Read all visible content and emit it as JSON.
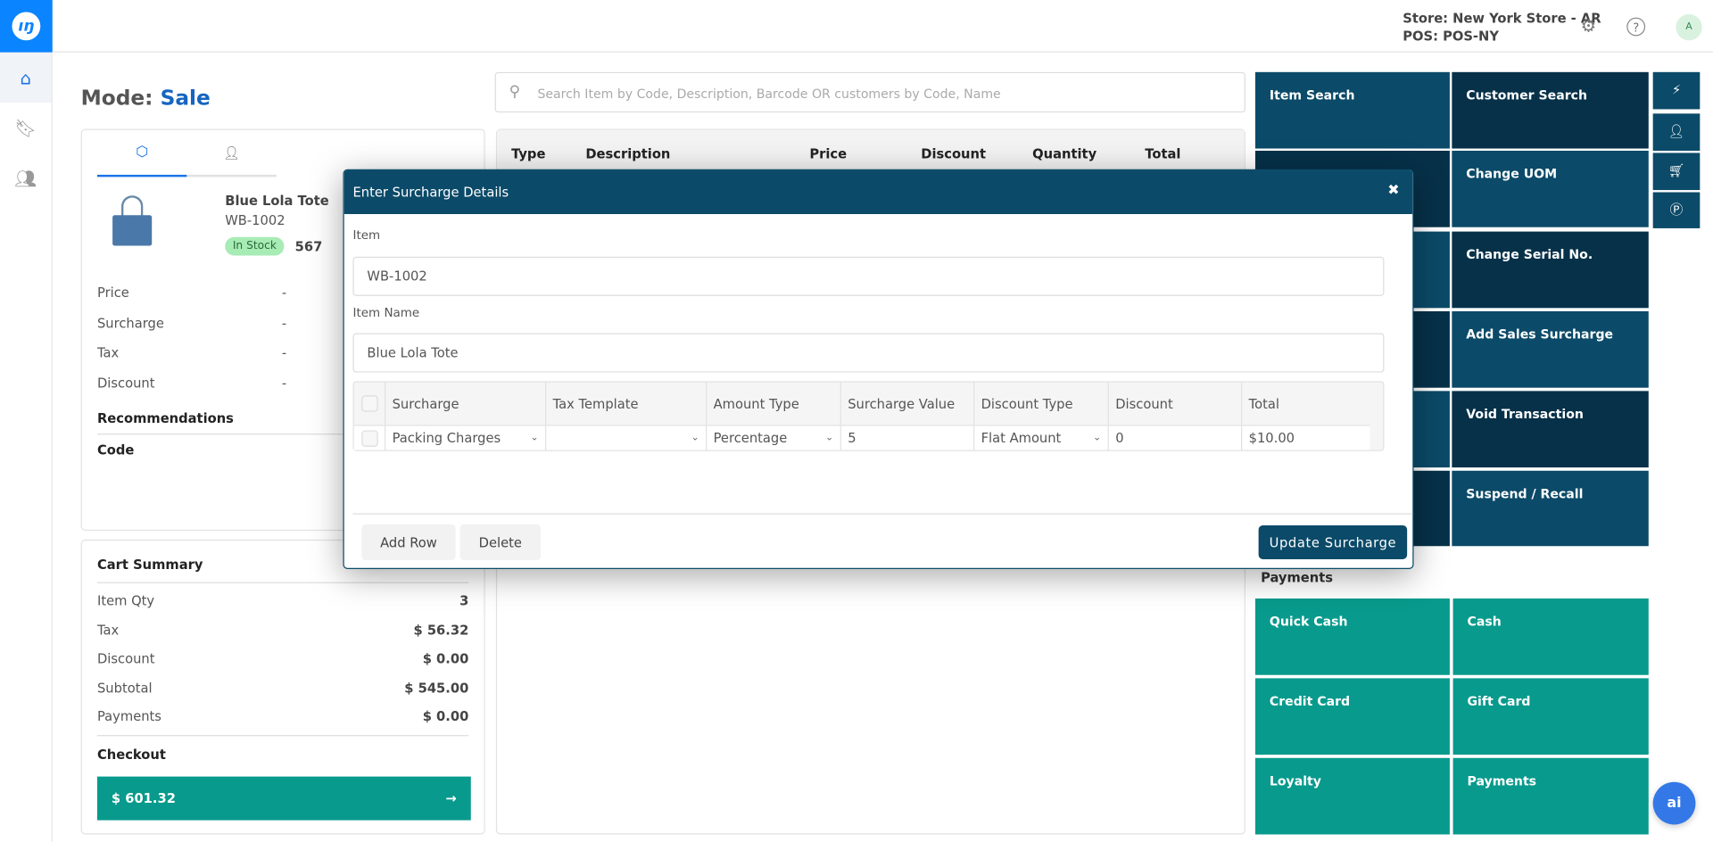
{
  "header": {
    "store": "Store: New York Store - AR",
    "pos": "POS: POS-NY",
    "avatar": "A"
  },
  "mode": {
    "label": "Mode:",
    "value": "Sale"
  },
  "search": {
    "placeholder": "Search Item by Code, Description, Barcode OR customers by Code, Name"
  },
  "product": {
    "name": "Blue Lola Tote",
    "code": "WB-1002",
    "stock_badge": "In Stock",
    "stock_qty": "567",
    "rows": [
      {
        "label": "Price",
        "value": "-"
      },
      {
        "label": "Surcharge",
        "value": "-"
      },
      {
        "label": "Tax",
        "value": "-"
      },
      {
        "label": "Discount",
        "value": "-"
      }
    ],
    "recommendations": "Recommendations",
    "code_header": "Code"
  },
  "cart": {
    "title": "Cart Summary",
    "rows": [
      {
        "label": "Item Qty",
        "value": "3"
      },
      {
        "label": "Tax",
        "value": "$ 56.32"
      },
      {
        "label": "Discount",
        "value": "$ 0.00"
      },
      {
        "label": "Subtotal",
        "value": "$ 545.00"
      },
      {
        "label": "Payments",
        "value": "$ 0.00"
      }
    ],
    "checkout_label": "Checkout",
    "checkout_amount": "$ 601.32"
  },
  "table": {
    "columns": [
      "Type",
      "Description",
      "Price",
      "Discount",
      "Quantity",
      "Total"
    ]
  },
  "actions": {
    "left": [
      "Item Search",
      "",
      "",
      "",
      "",
      ""
    ],
    "right": [
      "Customer Search",
      "Change UOM",
      "Change Serial No.",
      "Add Sales Surcharge",
      "Void Transaction",
      "Suspend / Recall"
    ]
  },
  "quick_icons": [
    "bolt-icon",
    "user-icon",
    "cart-icon",
    "points-icon"
  ],
  "payments": {
    "title": "Payments",
    "items": [
      "Quick Cash",
      "Cash",
      "Credit Card",
      "Gift Card",
      "Loyalty",
      "Payments"
    ]
  },
  "modal": {
    "title": "Enter Surcharge Details",
    "item_label": "Item",
    "item_value": "WB-1002",
    "name_label": "Item Name",
    "name_value": "Blue Lola Tote",
    "columns": [
      "Surcharge",
      "Tax Template",
      "Amount Type",
      "Surcharge Value",
      "Discount Type",
      "Discount",
      "Total"
    ],
    "row": {
      "surcharge": "Packing Charges",
      "tax_template": "",
      "amount_type": "Percentage",
      "surcharge_value": "5",
      "discount_type": "Flat Amount",
      "discount": "0",
      "total": "$10.00"
    },
    "add_row": "Add Row",
    "delete": "Delete",
    "update": "Update Surcharge"
  },
  "ai_label": "ai",
  "colors": {
    "primary": "#0b4a68",
    "dark": "#063149",
    "teal": "#089a8c",
    "accent": "#0a84ff"
  }
}
